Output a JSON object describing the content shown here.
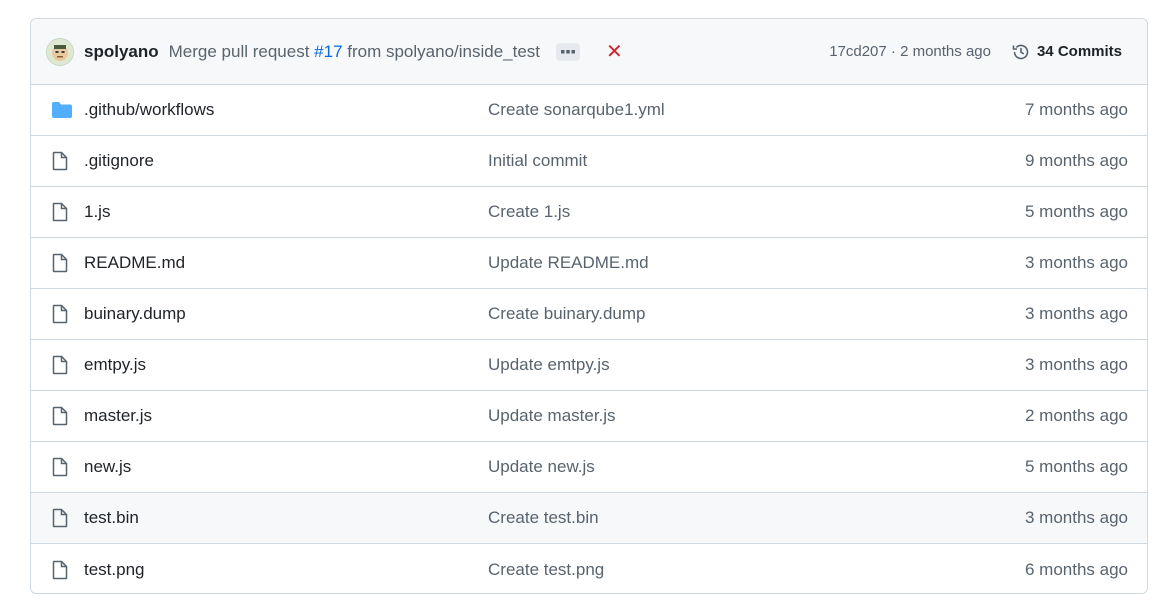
{
  "header": {
    "author": "spolyano",
    "commit_message_prefix": "Merge pull request ",
    "pr_number": "#17",
    "commit_message_suffix": " from spolyano/inside_test",
    "sha_and_time": "17cd207 · 2 months ago",
    "commits_label": "34 Commits",
    "status_icon": "x-icon"
  },
  "files": [
    {
      "name": ".github/workflows",
      "type": "folder",
      "message": "Create sonarqube1.yml",
      "time": "7 months ago"
    },
    {
      "name": ".gitignore",
      "type": "file",
      "message": "Initial commit",
      "time": "9 months ago"
    },
    {
      "name": "1.js",
      "type": "file",
      "message": "Create 1.js",
      "time": "5 months ago"
    },
    {
      "name": "README.md",
      "type": "file",
      "message": "Update README.md",
      "time": "3 months ago"
    },
    {
      "name": "buinary.dump",
      "type": "file",
      "message": "Create buinary.dump",
      "time": "3 months ago"
    },
    {
      "name": "emtpy.js",
      "type": "file",
      "message": "Update emtpy.js",
      "time": "3 months ago"
    },
    {
      "name": "master.js",
      "type": "file",
      "message": "Update master.js",
      "time": "2 months ago"
    },
    {
      "name": "new.js",
      "type": "file",
      "message": "Update new.js",
      "time": "5 months ago"
    },
    {
      "name": "test.bin",
      "type": "file",
      "message": "Create test.bin",
      "time": "3 months ago"
    },
    {
      "name": "test.png",
      "type": "file",
      "message": "Create test.png",
      "time": "6 months ago"
    }
  ],
  "colors": {
    "folder": "#54aeff",
    "link": "#0969da",
    "error": "#d1242f",
    "muted": "#59636e"
  }
}
